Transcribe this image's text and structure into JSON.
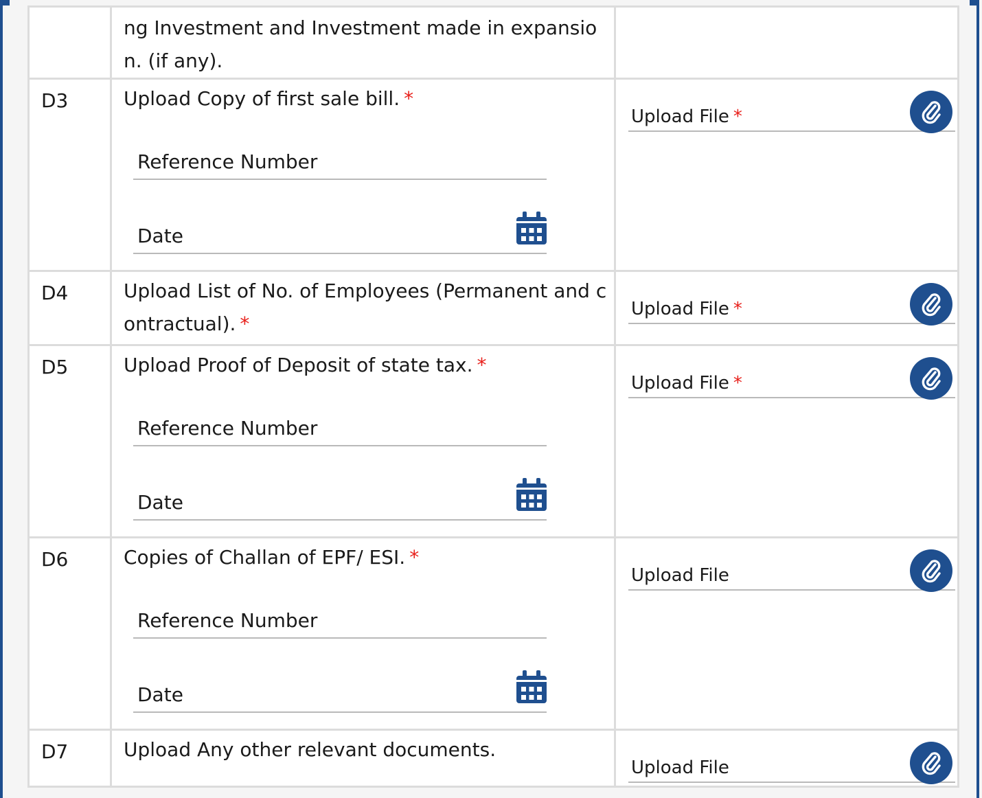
{
  "top_row": {
    "description": "ng Investment and Investment made in expansion. (if any)."
  },
  "rows": [
    {
      "code": "D3",
      "label": "Upload Copy of first sale bill.",
      "required": "*",
      "reference_placeholder": "Reference Number",
      "date_placeholder": "Date",
      "upload_label": "Upload File",
      "upload_required": "*"
    },
    {
      "code": "D4",
      "label": "Upload List of No. of Employees (Permanent and contractual).",
      "required": "*",
      "upload_label": "Upload File",
      "upload_required": "*"
    },
    {
      "code": "D5",
      "label": "Upload Proof of Deposit of state tax.",
      "required": "*",
      "reference_placeholder": "Reference Number",
      "date_placeholder": "Date",
      "upload_label": "Upload File",
      "upload_required": "*"
    },
    {
      "code": "D6",
      "label": "Copies of Challan of EPF/ ESI.",
      "required": "*",
      "reference_placeholder": "Reference Number",
      "date_placeholder": "Date",
      "upload_label": "Upload File"
    },
    {
      "code": "D7",
      "label": "Upload Any other relevant documents.",
      "upload_label": "Upload File"
    }
  ],
  "colors": {
    "accent": "#1f4f8f",
    "required": "#e8201b",
    "border": "#dcdcdc"
  },
  "icons": {
    "calendar": "calendar-icon",
    "attach": "paperclip-icon"
  }
}
